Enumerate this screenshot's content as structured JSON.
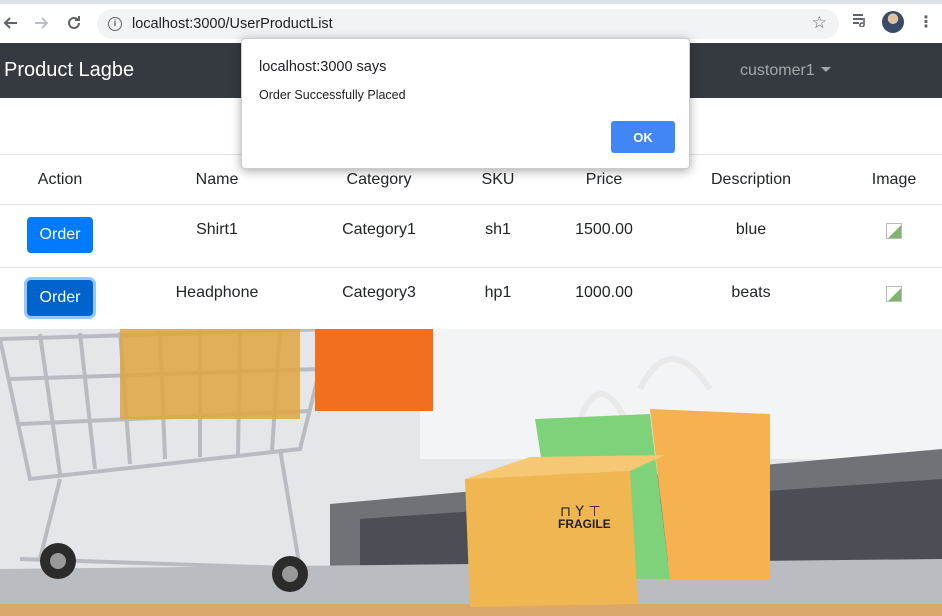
{
  "browser": {
    "url": "localhost:3000/UserProductList"
  },
  "navbar": {
    "brand": "Product Lagbe",
    "user": "customer1"
  },
  "table": {
    "headers": [
      "Action",
      "Name",
      "Category",
      "SKU",
      "Price",
      "Description",
      "Image"
    ],
    "rows": [
      {
        "action": "Order",
        "name": "Shirt1",
        "category": "Category1",
        "sku": "sh1",
        "price": "1500.00",
        "description": "blue"
      },
      {
        "action": "Order",
        "name": "Headphone",
        "category": "Category3",
        "sku": "hp1",
        "price": "1000.00",
        "description": "beats"
      }
    ]
  },
  "hero": {
    "box_label": "FRAGILE"
  },
  "dialog": {
    "title": "localhost:3000 says",
    "message": "Order Successfully Placed",
    "ok_label": "OK"
  },
  "colors": {
    "navbar": "#343a40",
    "primary": "#007bff",
    "dialog_button": "#4285f4"
  }
}
